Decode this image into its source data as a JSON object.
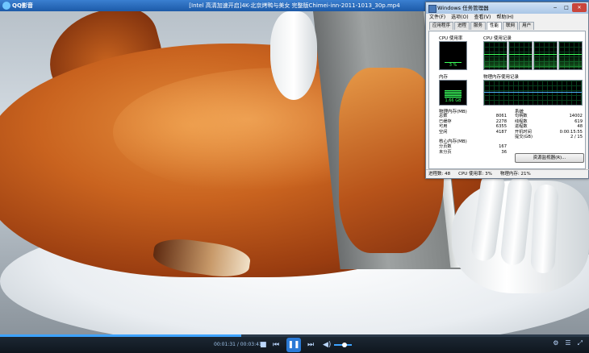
{
  "player": {
    "app_name": "QQ影音",
    "title": "[Intel 高清加速开启]4K-北京烤鸭与美女 完整版Chimei-inn-2011-1013_30p.mp4",
    "time": "00:01:31 / 00:03:41",
    "progress": 0.41,
    "volume": 0.6,
    "window_buttons": [
      "▾",
      "−",
      "□",
      "✕"
    ]
  },
  "taskmgr": {
    "title": "Windows 任务管理器",
    "menu": [
      "文件(F)",
      "选项(O)",
      "查看(V)",
      "帮助(H)"
    ],
    "tabs": [
      "应用程序",
      "进程",
      "服务",
      "性能",
      "联网",
      "用户"
    ],
    "active_tab": "性能",
    "cpu_usage_label": "CPU 使用率",
    "cpu_history_label": "CPU 使用记录",
    "cpu_value": "3 %",
    "cpu_fraction": 0.03,
    "mem_label": "内存",
    "mem_history_label": "物理内存使用记录",
    "mem_value": "1.66 GB",
    "physical_memory_header": "物理内存(MB)",
    "physical_memory": [
      {
        "k": "总数",
        "v": "8061"
      },
      {
        "k": "已缓存",
        "v": "2278"
      },
      {
        "k": "可用",
        "v": "6355"
      },
      {
        "k": "空闲",
        "v": "4187"
      }
    ],
    "system_header": "系统",
    "system": [
      {
        "k": "句柄数",
        "v": "14002"
      },
      {
        "k": "线程数",
        "v": "619"
      },
      {
        "k": "进程数",
        "v": "48"
      },
      {
        "k": "开机时间",
        "v": "0:00:15:55"
      },
      {
        "k": "提交(GB)",
        "v": "2 / 15"
      }
    ],
    "kernel_memory_header": "核心内存(MB)",
    "kernel_memory": [
      {
        "k": "分页数",
        "v": "167"
      },
      {
        "k": "未分页",
        "v": "36"
      }
    ],
    "resmon_button": "资源监视器(R)...",
    "status": {
      "processes": "进程数: 48",
      "cpu": "CPU 使用率: 3%",
      "memory": "物理内存: 21%"
    }
  }
}
